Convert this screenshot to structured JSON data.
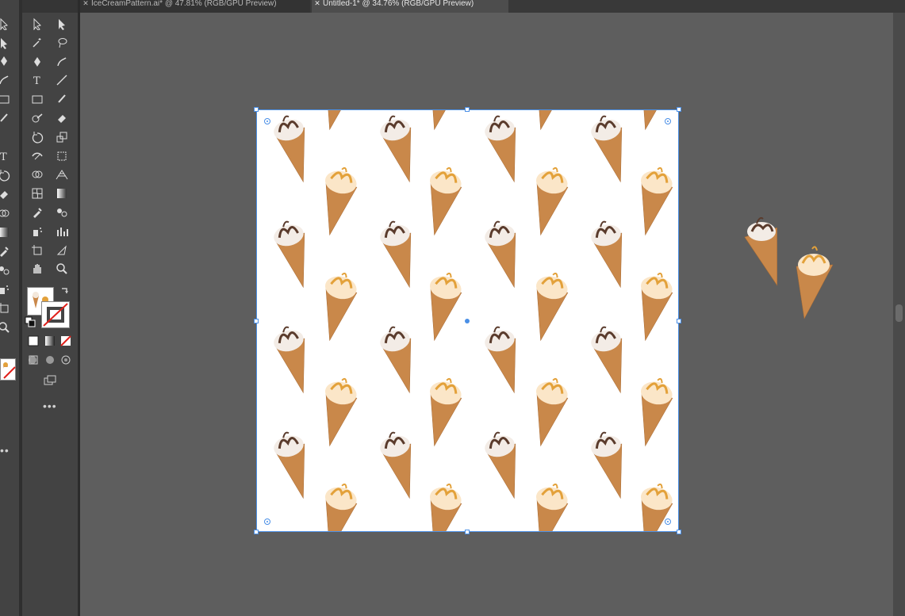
{
  "tabs": [
    {
      "label": "IceCreamPattern.ai* @ 47.81% (RGB/GPU Preview)",
      "active": false
    },
    {
      "label": "Untitled-1* @ 34.76% (RGB/GPU Preview)",
      "active": true
    }
  ],
  "tools": {
    "left_strip": [
      "selection-icon",
      "direct-selection-icon",
      "pen-icon",
      "curvature-icon",
      "rectangle-icon",
      "paintbrush-icon",
      "pencil-icon",
      "type-icon",
      "rotate-icon",
      "eraser-icon",
      "shape-builder-icon",
      "gradient-icon",
      "eyedropper-icon",
      "blend-icon",
      "symbol-sprayer-icon",
      "artboard-icon",
      "zoom-icon",
      "swap-icon",
      "fill-swatch-icon",
      "color-mode-icon",
      "draw-mode-icon",
      "screen-mode-icon",
      "more-icon"
    ],
    "main_panel": [
      "selection-icon",
      "direct-selection-icon",
      "magic-wand-icon",
      "lasso-icon",
      "pen-icon",
      "curvature-icon",
      "type-icon",
      "line-segment-icon",
      "rectangle-icon",
      "paintbrush-icon",
      "shaper-icon",
      "eraser-icon",
      "rotate-icon",
      "scale-icon",
      "width-icon",
      "free-transform-icon",
      "shape-builder-icon",
      "perspective-grid-icon",
      "mesh-icon",
      "gradient-icon",
      "eyedropper-icon",
      "blend-icon",
      "symbol-sprayer-icon",
      "column-graph-icon",
      "artboard-icon",
      "slice-icon",
      "hand-icon",
      "zoom-icon"
    ]
  },
  "colors": {
    "selection": "#4a8fe6",
    "cone": "#c9884a",
    "chocolate": "#5a3b2c",
    "caramel": "#e3a13a"
  }
}
